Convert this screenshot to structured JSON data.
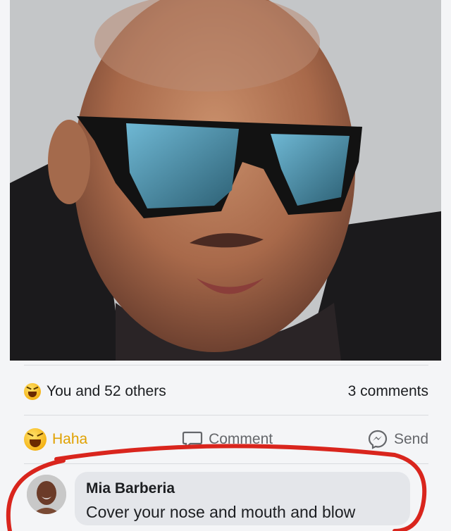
{
  "post": {
    "photo_alt": "Man with shaved head wearing large black sunglasses"
  },
  "reactions": {
    "summary": "You and 52 others",
    "comments_count": "3 comments"
  },
  "actions": {
    "haha": "Haha",
    "comment": "Comment",
    "send": "Send"
  },
  "comment": {
    "author": "Mia Barberia",
    "text": "Cover your nose and mouth and blow"
  },
  "colors": {
    "haha_accent": "#e0a100",
    "annotation_red": "#d9251d",
    "bubble": "#e4e6ea"
  },
  "icons": [
    "haha-emoji-icon",
    "comment-icon",
    "messenger-icon"
  ]
}
